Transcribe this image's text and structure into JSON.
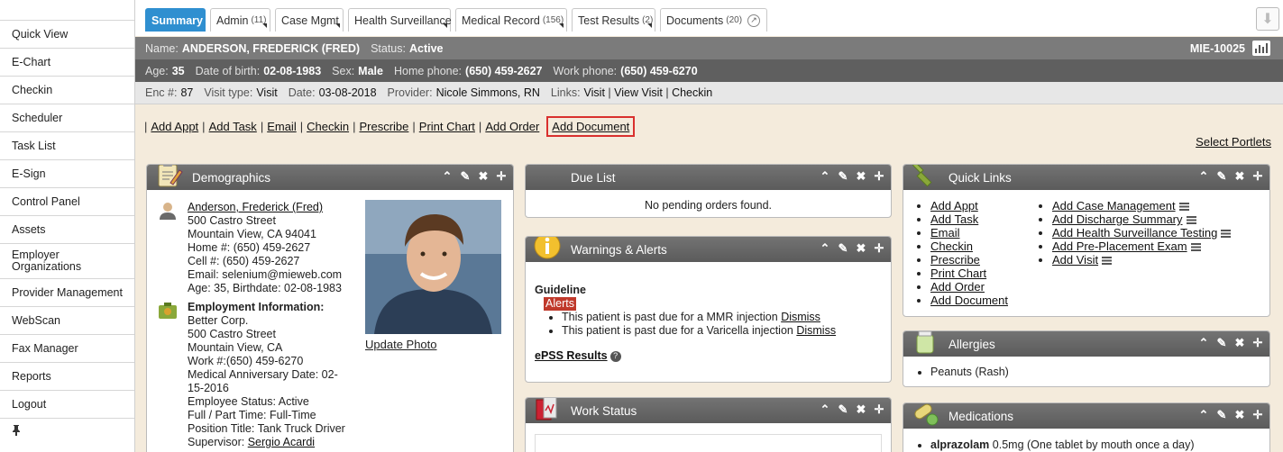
{
  "sidebar": {
    "items": [
      {
        "label": "Quick View"
      },
      {
        "label": "E-Chart"
      },
      {
        "label": "Checkin"
      },
      {
        "label": "Scheduler"
      },
      {
        "label": "Task List"
      },
      {
        "label": "E-Sign"
      },
      {
        "label": "Control Panel"
      },
      {
        "label": "Assets"
      },
      {
        "label": "Employer Organizations"
      },
      {
        "label": "Provider Management"
      },
      {
        "label": "WebScan"
      },
      {
        "label": "Fax Manager"
      },
      {
        "label": "Reports"
      },
      {
        "label": "Logout"
      }
    ],
    "pin_icon": "pin-icon"
  },
  "tabs": [
    {
      "label": "Summary",
      "count": ""
    },
    {
      "label": "Admin",
      "count": "(11)"
    },
    {
      "label": "Case Mgmt",
      "count": ""
    },
    {
      "label": "Health Surveillance",
      "count": ""
    },
    {
      "label": "Medical Record",
      "count": "(156)"
    },
    {
      "label": "Test Results",
      "count": "(2)"
    },
    {
      "label": "Documents",
      "count": "(20)"
    }
  ],
  "patient": {
    "name_label": "Name:",
    "name": "ANDERSON, FREDERICK (FRED)",
    "status_label": "Status:",
    "status": "Active",
    "mrn": "MIE-10025",
    "age_label": "Age:",
    "age": "35",
    "dob_label": "Date of birth:",
    "dob": "02-08-1983",
    "sex_label": "Sex:",
    "sex": "Male",
    "home_phone_label": "Home phone:",
    "home_phone": "(650) 459-2627",
    "work_phone_label": "Work phone:",
    "work_phone": "(650) 459-6270"
  },
  "encounter": {
    "enc_label": "Enc #:",
    "enc": "87",
    "visit_type_label": "Visit type:",
    "visit_type": "Visit",
    "date_label": "Date:",
    "date": "03-08-2018",
    "provider_label": "Provider:",
    "provider": "Nicole Simmons, RN",
    "links_label": "Links:",
    "link_visit": "Visit",
    "link_view_visit": "View Visit",
    "link_checkin": "Checkin"
  },
  "actions": {
    "add_appt": "Add Appt",
    "add_task": "Add Task",
    "email": "Email",
    "checkin": "Checkin",
    "prescribe": "Prescribe",
    "print_chart": "Print Chart",
    "add_order": "Add Order",
    "add_document": "Add Document",
    "select_portlets": "Select Portlets"
  },
  "demographics": {
    "title": "Demographics",
    "name_link": "Anderson, Frederick (Fred)",
    "address1": "500 Castro Street",
    "address2": "Mountain View, CA 94041",
    "home": "Home #: (650) 459-2627",
    "cell": "Cell #: (650) 459-2627",
    "email": "Email: selenium@mieweb.com",
    "age_birth": "Age: 35, Birthdate: 02-08-1983",
    "employment_title": "Employment Information:",
    "employer": "Better Corp.",
    "emp_address1": "500 Castro Street",
    "emp_address2": "Mountain View, CA",
    "work": "Work #:(650) 459-6270",
    "anniv1": "Medical Anniversary Date: 02-",
    "anniv2": "15-2016",
    "emp_status": "Employee Status: Active",
    "full_part": "Full / Part Time: Full-Time",
    "position": "Position Title: Tank Truck Driver",
    "supervisor_label": "Supervisor:",
    "supervisor": "Sergio Acardi",
    "update_photo": "Update Photo"
  },
  "due_list": {
    "title": "Due List",
    "empty": "No pending orders found."
  },
  "warnings": {
    "title": "Warnings & Alerts",
    "guideline": "Guideline",
    "alerts_tag": "Alerts",
    "items": [
      {
        "text": "This patient is past due for a MMR injection",
        "action": "Dismiss"
      },
      {
        "text": "This patient is past due for a Varicella injection",
        "action": "Dismiss"
      }
    ],
    "epss": "ePSS Results"
  },
  "work_status": {
    "title": "Work Status"
  },
  "quick_links": {
    "title": "Quick Links",
    "col1": [
      "Add Appt",
      "Add Task",
      "Email",
      "Checkin",
      "Prescribe",
      "Print Chart",
      "Add Order",
      "Add Document"
    ],
    "col2": [
      "Add Case Management",
      "Add Discharge Summary",
      "Add Health Surveillance Testing",
      "Add Pre-Placement Exam",
      "Add Visit"
    ]
  },
  "allergies": {
    "title": "Allergies",
    "items": [
      "Peanuts (Rash)"
    ]
  },
  "medications": {
    "title": "Medications",
    "items": [
      {
        "name": "alprazolam",
        "detail": "0.5mg (One tablet by mouth once a day)"
      }
    ]
  },
  "colors": {
    "tab_active": "#2f8fd0",
    "header_dark": "#5f5f5f",
    "highlight_box": "#d9302e",
    "alert_tag": "#c0392b"
  }
}
